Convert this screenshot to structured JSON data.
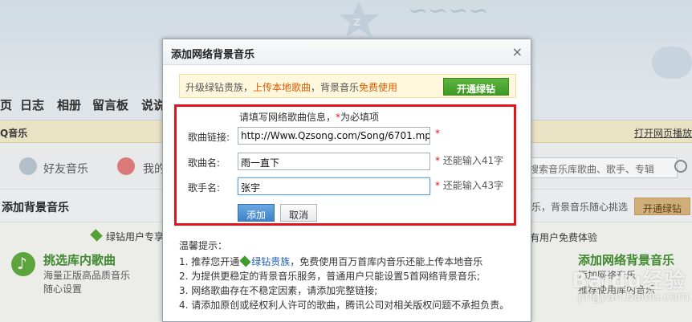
{
  "background": {
    "nav": [
      "页",
      "日志",
      "相册",
      "留言板",
      "说说"
    ],
    "music_bar_left": "Q音乐",
    "music_bar_right": "打开网页播放",
    "tabs": [
      "好友音乐",
      "我的"
    ],
    "search_placeholder": "搜索音乐库歌曲、歌手、专辑",
    "section_title": "添加背景音乐",
    "section_tip": "乐，背景音乐随心挑选",
    "open_vip": "开通绿钻",
    "panel_head": "绿钻用户专享",
    "panel_right_head": "有用户免费体验",
    "pick_title": "挑选库内歌曲",
    "pick_sub1": "海量正版高品质音乐",
    "pick_sub2": "随心设置",
    "right_title": "添加网络背景音乐",
    "right_sub1": "添加网络音乐",
    "right_sub2": "推荐使用库内音乐",
    "watermark": "Baidu经验",
    "watermark_sub": "jingyan.baidu.com"
  },
  "dialog": {
    "title": "添加网络背景音乐",
    "close": "×",
    "upsell": {
      "prefix": "升级绿钻贵族，",
      "highlight1": "上传本地歌曲",
      "middle": "，背景音乐",
      "highlight2": "免费使用",
      "button": "开通绿钻"
    },
    "form": {
      "hint_prefix": "请填写网络歌曲信息，",
      "hint_star": "*",
      "hint_suffix": "为必填项",
      "link_label": "歌曲链接:",
      "link_value": "http://Www.Qzsong.com/Song/6701.mp3",
      "name_label": "歌曲名:",
      "name_value": "雨一直下",
      "name_note": "还能输入41字",
      "singer_label": "歌手名:",
      "singer_value": "张宇",
      "singer_note": "还能输入43字",
      "star": "*",
      "add_button": "添加",
      "cancel_button": "取消"
    },
    "tips": {
      "title": "温馨提示：",
      "tip1_a": "1. 推荐您开通",
      "tip1_link": "绿钻贵族",
      "tip1_b": "，免费使用百万首库内音乐还能上传本地音乐",
      "tip2": "2. 为提供更稳定的背景音乐服务，普通用户只能设置5首网络背景音乐;",
      "tip3": "3. 网络歌曲存在不稳定因素，请添加完整链接;",
      "tip4": "4. 请添加原创或经权利人许可的歌曲，腾讯公司对相关版权问题不承担负责。"
    }
  }
}
